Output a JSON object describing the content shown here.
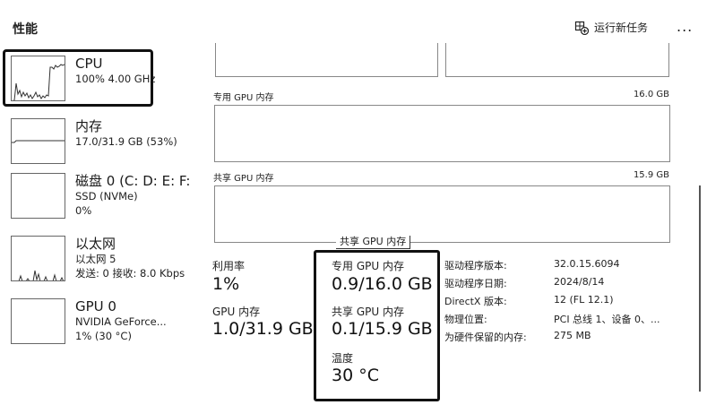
{
  "header": {
    "title": "性能",
    "run_new_task": "运行新任务",
    "more": "..."
  },
  "sidebar": {
    "items": [
      {
        "name": "CPU",
        "sub1": "100% 4.00 GHz",
        "sub2": ""
      },
      {
        "name": "内存",
        "sub1": "17.0/31.9 GB (53%)",
        "sub2": ""
      },
      {
        "name": "磁盘 0 (C: D: E: F:",
        "sub1": "SSD (NVMe)",
        "sub2": "0%"
      },
      {
        "name": "以太网",
        "sub1": "以太网 5",
        "sub2": "发送: 0 接收: 8.0 Kbps"
      },
      {
        "name": "GPU 0",
        "sub1": "NVIDIA GeForce...",
        "sub2": "1% (30 °C)"
      }
    ]
  },
  "main": {
    "dedicated_label": "专用 GPU 内存",
    "dedicated_max": "16.0 GB",
    "shared_label": "共享 GPU 内存",
    "shared_max": "15.9 GB",
    "tooltip": "共享 GPU 内存",
    "stats": {
      "util_label": "利用率",
      "util_value": "1%",
      "gpu_mem_label": "GPU 内存",
      "gpu_mem_value": "1.0/31.9 GB",
      "dedicated_label": "专用 GPU 内存",
      "dedicated_value": "0.9/16.0 GB",
      "shared_label": "共享 GPU 内存",
      "shared_value": "0.1/15.9 GB",
      "temp_label": "温度",
      "temp_value": "30 °C"
    },
    "properties": [
      {
        "key": "驱动程序版本:",
        "value": "32.0.15.6094"
      },
      {
        "key": "驱动程序日期:",
        "value": "2024/8/14"
      },
      {
        "key": "DirectX 版本:",
        "value": "12 (FL 12.1)"
      },
      {
        "key": "物理位置:",
        "value": "PCI 总线 1、设备 0、..."
      },
      {
        "key": "为硬件保留的内存:",
        "value": "275 MB"
      }
    ]
  },
  "icons": {
    "run_task": "run-task-icon",
    "more": "more-icon"
  }
}
